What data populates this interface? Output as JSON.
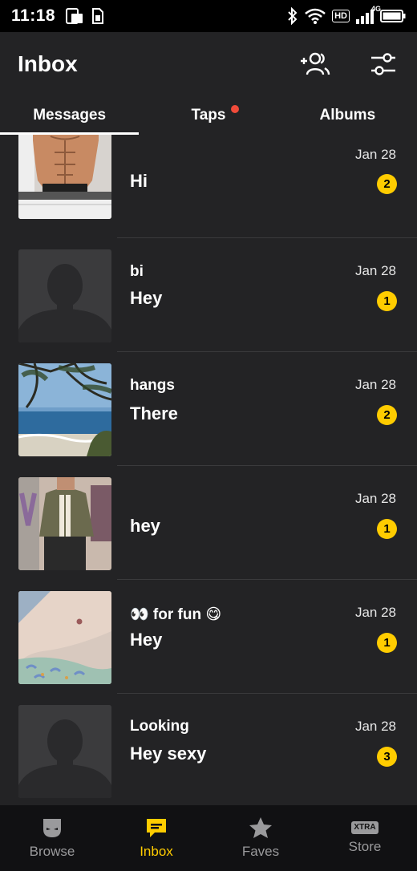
{
  "status_bar": {
    "time": "11:18",
    "network": "4G",
    "hd": "HD"
  },
  "header": {
    "title": "Inbox",
    "add_people_icon": "add-people-icon",
    "filter_icon": "sliders-icon"
  },
  "tabs": [
    {
      "label": "Messages",
      "active": true
    },
    {
      "label": "Taps",
      "has_dot": true
    },
    {
      "label": "Albums"
    }
  ],
  "conversations": [
    {
      "name": "",
      "message": "Hi",
      "date": "Jan 28",
      "unread": "2",
      "avatar": "torso-photo"
    },
    {
      "name": "bi",
      "message": "Hey",
      "date": "Jan 28",
      "unread": "1",
      "avatar": "placeholder-silhouette"
    },
    {
      "name": "hangs",
      "message": "There",
      "date": "Jan 28",
      "unread": "2",
      "avatar": "beach-photo"
    },
    {
      "name": "",
      "message": "hey",
      "date": "Jan 28",
      "unread": "1",
      "avatar": "jacket-photo"
    },
    {
      "name": "👀 for fun 😋",
      "message": "Hey",
      "date": "Jan 28",
      "unread": "1",
      "avatar": "skin-photo"
    },
    {
      "name": "Looking",
      "message": "Hey sexy",
      "date": "Jan 28",
      "unread": "3",
      "avatar": "placeholder-silhouette"
    }
  ],
  "bottom_nav": [
    {
      "label": "Browse",
      "icon": "mask-icon"
    },
    {
      "label": "Inbox",
      "icon": "chat-bubble-icon",
      "active": true
    },
    {
      "label": "Faves",
      "icon": "star-icon"
    },
    {
      "label": "Store",
      "icon": "xtra-icon",
      "badge": "XTRA"
    }
  ],
  "colors": {
    "accent": "#ffcc00",
    "background": "#232325",
    "nav_background": "#111113",
    "notification_dot": "#f04b3a"
  }
}
